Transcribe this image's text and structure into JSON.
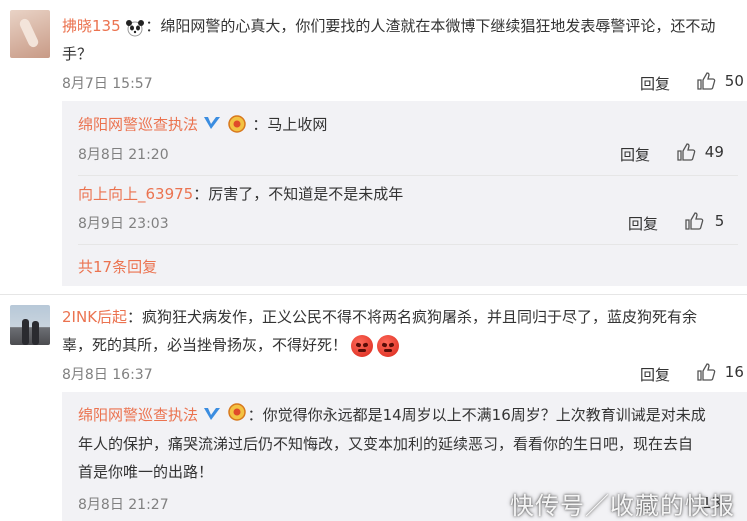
{
  "comments": [
    {
      "user": "拂晓135",
      "text_line1": "：绵阳网警的心真大，你们要找的人渣就在本微博下继续猖狂地发表辱警评论，还不动",
      "text_line2": "手？",
      "time": "8月7日 15:57",
      "reply_label": "回复",
      "likes": "50",
      "replies": [
        {
          "user": "绵阳网警巡查执法",
          "text": "：马上收网",
          "time": "8月8日 21:20",
          "reply_label": "回复",
          "likes": "49"
        },
        {
          "user": "向上向上_63975",
          "text": "：厉害了，不知道是不是未成年",
          "time": "8月9日 23:03",
          "reply_label": "回复",
          "likes": "5"
        }
      ],
      "more_replies": "共17条回复"
    },
    {
      "user": "2INK后起",
      "text_line1": "：疯狗狂犬病发作，正义公民不得不将两名疯狗屠杀，并且同归于尽了，蓝皮狗死有余",
      "text_line2": "辜，死的其所，必当挫骨扬灰，不得好死！",
      "time": "8月8日 16:37",
      "reply_label": "回复",
      "likes": "16",
      "replies": [
        {
          "user": "绵阳网警巡查执法",
          "text_line1": "：你觉得你永远都是14周岁以上不满16周岁？上次教育训诫是对未成",
          "text_line2": "年人的保护，痛哭流涕过后仍不知悔改，又变本加利的延续恶习，看看你的生日吧，现在去自",
          "text_line3": "首是你唯一的出路！",
          "time": "8月8日 21:27",
          "likes": "13"
        }
      ]
    }
  ],
  "watermark": "快传号／收藏的快报",
  "colors": {
    "name": "#eb7350",
    "reply_bg": "#f2f2f5"
  }
}
